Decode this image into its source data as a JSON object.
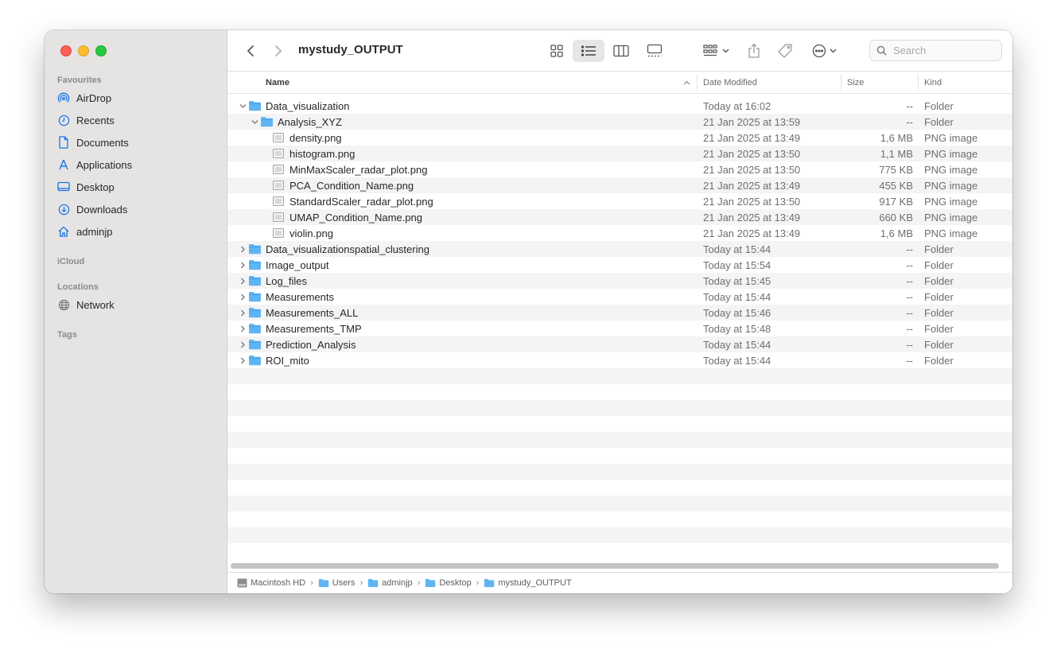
{
  "window": {
    "title": "mystudy_OUTPUT"
  },
  "sidebar": {
    "favourites_label": "Favourites",
    "favourites": [
      {
        "label": "AirDrop",
        "icon": "airdrop-icon"
      },
      {
        "label": "Recents",
        "icon": "clock-icon"
      },
      {
        "label": "Documents",
        "icon": "document-icon"
      },
      {
        "label": "Applications",
        "icon": "applications-icon"
      },
      {
        "label": "Desktop",
        "icon": "desktop-icon"
      },
      {
        "label": "Downloads",
        "icon": "download-icon"
      },
      {
        "label": "adminjp",
        "icon": "home-icon"
      }
    ],
    "icloud_label": "iCloud",
    "locations_label": "Locations",
    "locations": [
      {
        "label": "Network",
        "icon": "network-icon"
      }
    ],
    "tags_label": "Tags"
  },
  "search": {
    "placeholder": "Search"
  },
  "columns": {
    "name": "Name",
    "date": "Date Modified",
    "size": "Size",
    "kind": "Kind"
  },
  "rows": [
    {
      "name": "Data_visualization",
      "date": "Today at 16:02",
      "size": "--",
      "kind": "Folder",
      "type": "folder",
      "level": 0,
      "expanded": true
    },
    {
      "name": "Analysis_XYZ",
      "date": "21 Jan 2025 at 13:59",
      "size": "--",
      "kind": "Folder",
      "type": "folder",
      "level": 1,
      "expanded": true
    },
    {
      "name": "density.png",
      "date": "21 Jan 2025 at 13:49",
      "size": "1,6 MB",
      "kind": "PNG image",
      "type": "file",
      "level": 2
    },
    {
      "name": "histogram.png",
      "date": "21 Jan 2025 at 13:50",
      "size": "1,1 MB",
      "kind": "PNG image",
      "type": "file",
      "level": 2
    },
    {
      "name": "MinMaxScaler_radar_plot.png",
      "date": "21 Jan 2025 at 13:50",
      "size": "775 KB",
      "kind": "PNG image",
      "type": "file",
      "level": 2
    },
    {
      "name": "PCA_Condition_Name.png",
      "date": "21 Jan 2025 at 13:49",
      "size": "455 KB",
      "kind": "PNG image",
      "type": "file",
      "level": 2
    },
    {
      "name": "StandardScaler_radar_plot.png",
      "date": "21 Jan 2025 at 13:50",
      "size": "917 KB",
      "kind": "PNG image",
      "type": "file",
      "level": 2
    },
    {
      "name": "UMAP_Condition_Name.png",
      "date": "21 Jan 2025 at 13:49",
      "size": "660 KB",
      "kind": "PNG image",
      "type": "file",
      "level": 2
    },
    {
      "name": "violin.png",
      "date": "21 Jan 2025 at 13:49",
      "size": "1,6 MB",
      "kind": "PNG image",
      "type": "file",
      "level": 2
    },
    {
      "name": "Data_visualizationspatial_clustering",
      "date": "Today at 15:44",
      "size": "--",
      "kind": "Folder",
      "type": "folder",
      "level": 0,
      "expanded": false
    },
    {
      "name": "Image_output",
      "date": "Today at 15:54",
      "size": "--",
      "kind": "Folder",
      "type": "folder",
      "level": 0,
      "expanded": false
    },
    {
      "name": "Log_files",
      "date": "Today at 15:45",
      "size": "--",
      "kind": "Folder",
      "type": "folder",
      "level": 0,
      "expanded": false
    },
    {
      "name": "Measurements",
      "date": "Today at 15:44",
      "size": "--",
      "kind": "Folder",
      "type": "folder",
      "level": 0,
      "expanded": false
    },
    {
      "name": "Measurements_ALL",
      "date": "Today at 15:46",
      "size": "--",
      "kind": "Folder",
      "type": "folder",
      "level": 0,
      "expanded": false
    },
    {
      "name": "Measurements_TMP",
      "date": "Today at 15:48",
      "size": "--",
      "kind": "Folder",
      "type": "folder",
      "level": 0,
      "expanded": false
    },
    {
      "name": "Prediction_Analysis",
      "date": "Today at 15:44",
      "size": "--",
      "kind": "Folder",
      "type": "folder",
      "level": 0,
      "expanded": false
    },
    {
      "name": "ROI_mito",
      "date": "Today at 15:44",
      "size": "--",
      "kind": "Folder",
      "type": "folder",
      "level": 0,
      "expanded": false
    }
  ],
  "pathbar": [
    {
      "label": "Macintosh HD",
      "icon": "hard-drive-icon"
    },
    {
      "label": "Users",
      "icon": "folder-icon"
    },
    {
      "label": "adminjp",
      "icon": "home-folder-icon"
    },
    {
      "label": "Desktop",
      "icon": "folder-icon"
    },
    {
      "label": "mystudy_OUTPUT",
      "icon": "folder-icon"
    }
  ],
  "colors": {
    "folder": "#5eb5f2",
    "accent": "#1a73e8",
    "sidebar_bg": "#e5e4e3"
  }
}
